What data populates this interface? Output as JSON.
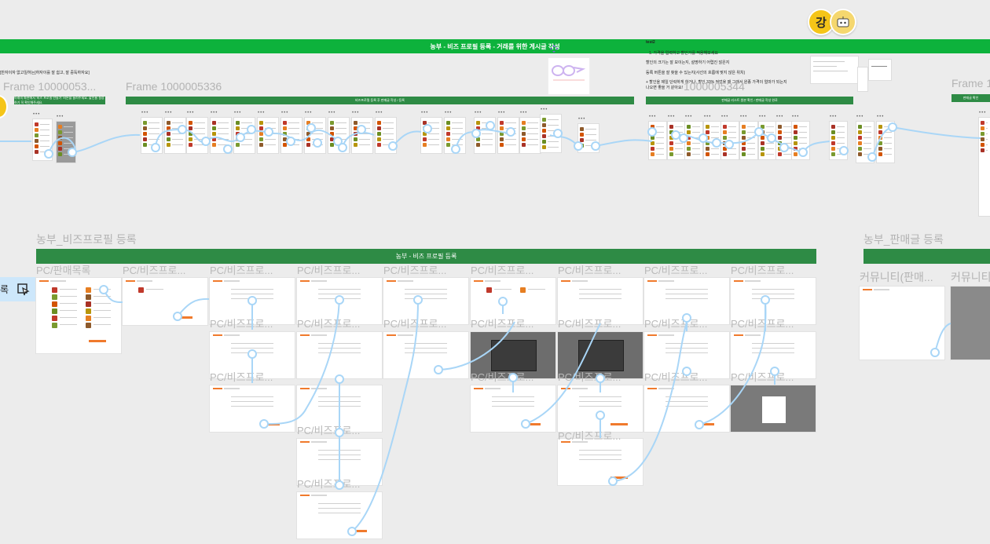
{
  "top_banner": {
    "title": "농부 - 비즈 프로필 등록 - 거래를 위한 게시글 작성"
  },
  "top_left_note": "[반자이자 없고일하는]하자이를 잘 쉽고, 잘 중독하자요]",
  "notes": {
    "title": "test2",
    "items": [
      "1. 가격을 입력하고 할인가를 적용해보세요",
      "할인의 크기는 잘 보이는지, 설명하기 어렵진 않은지",
      "등록 버튼을 잘 찾을 수 있는지(사선의 흐름에 맞지 않은 위치)",
      "+ 할인을 제일 단락하게 하거나, 할인 33% 적었을 때 그래서 원종 가격이 얼마가 되는지",
      "나오면 좋을 거 같아요!"
    ]
  },
  "frames_top": [
    {
      "label": "Frame 10000053...",
      "bar": "아래의 화면에서 '비즈 프로필 만들기' 버튼을 눌러주세요. 할인율 설정하기 꼭 확인해주세요."
    },
    {
      "label": "Frame 1000005336",
      "bar": "비즈프로필 등록 후 판매글 작성 / 등록"
    },
    {
      "label": "1000005344",
      "bar": "판매글 리스트 원본 확인 / 판매글 작성 완료"
    },
    {
      "label": "Frame 1",
      "bar": "판매글 확인"
    }
  ],
  "section_biz": {
    "title": "농부_비즈프로필 등록",
    "bar": "농부 - 비즈 프로필 등록",
    "flow_start_label": "록",
    "columns": [
      "PC/판매목록",
      "PC/비즈프로...",
      "PC/비즈프로...",
      "PC/비즈프로...",
      "PC/비즈프로...",
      "PC/비즈프로...",
      "PC/비즈프로...",
      "PC/비즈프로...",
      "PC/비즈프로..."
    ],
    "row_labels": [
      "PC/비즈프로...",
      "PC/비즈프로...",
      "PC/비즈프로...",
      "PC/비즈프로...",
      "PC/비즈프로...",
      "PC/비즈프로...",
      "PC/비즈프로...",
      "PC/비즈프로..."
    ]
  },
  "section_sale": {
    "title": "농부_판매글 등록",
    "columns": [
      "커뮤니티(판매...",
      "커뮤니티"
    ]
  },
  "avatars": [
    {
      "initial": "강",
      "color": "#f5c518"
    },
    {
      "initial": "",
      "color": "#f5c518"
    }
  ],
  "colors": {
    "green_banner": "#0db23c",
    "green_bar": "#2e8b45",
    "orange": "#f07a2c",
    "wire": "#a9d6f7",
    "canvas": "#ececec"
  }
}
